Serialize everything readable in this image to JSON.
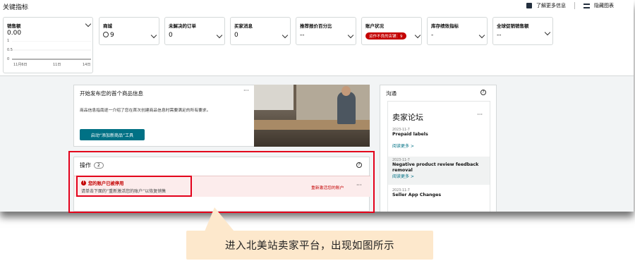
{
  "key_metrics": {
    "title": "关键指标",
    "learn_more": "了解更多信息",
    "hide_chart": "隐藏图表"
  },
  "cards": [
    {
      "label": "销售额",
      "value": "0.00"
    },
    {
      "label": "商城",
      "value": "9"
    },
    {
      "label": "未解决的订单",
      "value": "0"
    },
    {
      "label": "买家消息",
      "value": "0"
    },
    {
      "label": "推荐报价百分比",
      "value": "--"
    },
    {
      "label": "账户状况",
      "value": "运作不良的店铺：9"
    },
    {
      "label": "库存绩效指标",
      "value": "-"
    },
    {
      "label": "全球促销销售额",
      "value": "--"
    }
  ],
  "sales_chart": {
    "y_ticks": [
      "1",
      "0.5",
      "0"
    ],
    "x_ticks": [
      "11月6日",
      "11日",
      "14日"
    ]
  },
  "listing_card": {
    "title": "开始发布您的首个商品信息",
    "description": "商品信息指南逐一介绍了您在首次创建商品信息时需要满足的所有要求。",
    "button": "启动“添加新商品”工具",
    "more": "···"
  },
  "operations": {
    "title": "操作",
    "count": "2",
    "help": "?",
    "alert_icon": "!",
    "alert_title": "您的账户已被停用",
    "alert_desc": "请单击下面的“重新激活您的账户”以恢复销售",
    "alert_action": "重新激活您的账户",
    "alert_more": "···"
  },
  "communication": {
    "title": "沟通",
    "help": "?",
    "forum_title": "卖家论坛",
    "forum_more": "···",
    "posts": [
      {
        "date": "2023-11-7",
        "title": "Prepaid labels",
        "read_more": "阅读更多 >"
      },
      {
        "date": "2023-11-7",
        "title": "Negative product review feedback removal",
        "read_more": "阅读更多 >"
      },
      {
        "date": "2023-11-7",
        "title": "Seller App Changes",
        "read_more": ""
      }
    ]
  },
  "callout": {
    "text": "进入北美站卖家平台，出现如图所示"
  }
}
